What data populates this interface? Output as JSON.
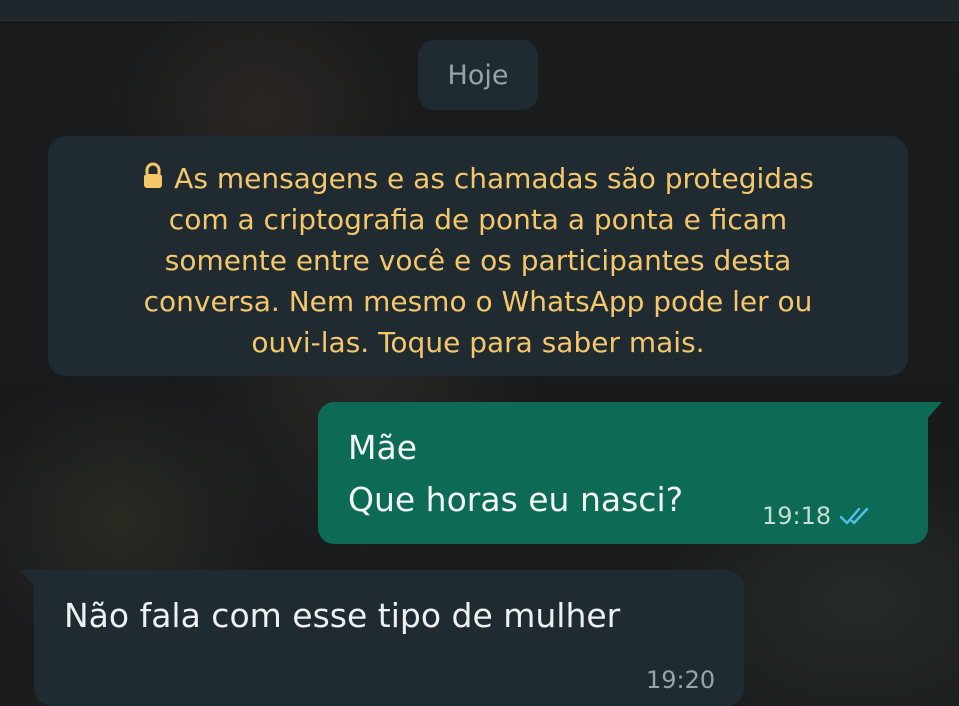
{
  "chat": {
    "date_chip": "Hoje",
    "encryption_notice": {
      "icon": "lock-icon",
      "lines": [
        "As mensagens e as chamadas são protegidas",
        "com a criptografia de ponta a ponta e ficam",
        "somente entre você e os participantes desta",
        "conversa. Nem mesmo o WhatsApp pode ler ou",
        "ouvi-las. Toque para saber mais."
      ]
    },
    "messages": [
      {
        "direction": "outgoing",
        "lines": [
          "Mãe",
          "Que horas eu nasci?"
        ],
        "time": "19:18",
        "status_icon": "double-check-icon"
      },
      {
        "direction": "incoming",
        "text": "Não fala com esse tipo de mulher",
        "time": "19:20"
      }
    ]
  },
  "colors": {
    "outgoing_bubble": "#0c6a55",
    "incoming_bubble": "#1f2a31",
    "notice_text": "#f4c76b",
    "read_ticks": "#53bdeb"
  }
}
